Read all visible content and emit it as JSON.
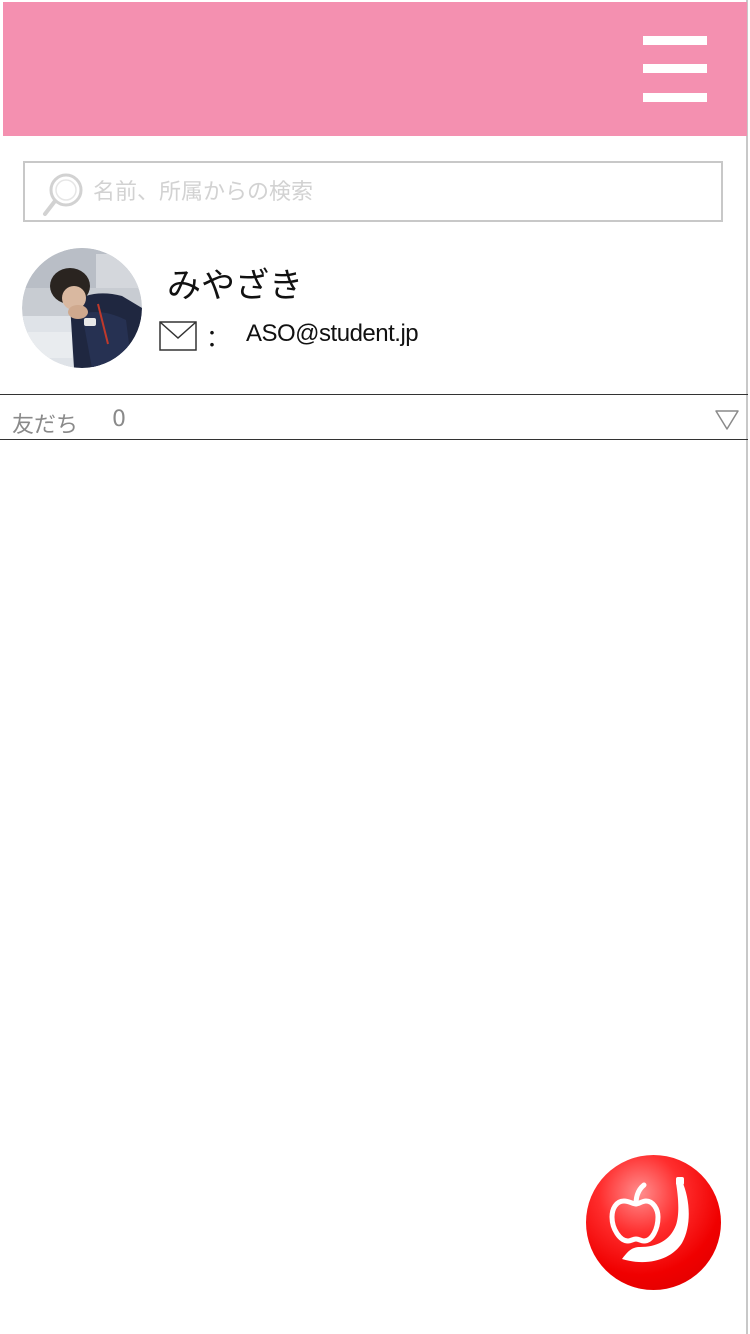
{
  "header": {
    "menu_icon": "hamburger-menu-icon"
  },
  "colors": {
    "header_bg": "#f490b0",
    "fab": "#f00000",
    "divider": "#333333",
    "placeholder": "#d2d2d2",
    "muted_text": "#8a8a8a"
  },
  "search": {
    "placeholder": "名前、所属からの検索",
    "value": "",
    "icon": "search-icon"
  },
  "profile": {
    "avatar_icon": "user-avatar",
    "name": "みやざき",
    "mail_icon": "envelope-icon",
    "separator": "：",
    "email": "ASO@student.jp"
  },
  "friends": {
    "label": "友だち",
    "count": "0",
    "toggle_icon": "triangle-down-icon"
  },
  "fab": {
    "icon": "fruit-apple-banana-icon"
  }
}
